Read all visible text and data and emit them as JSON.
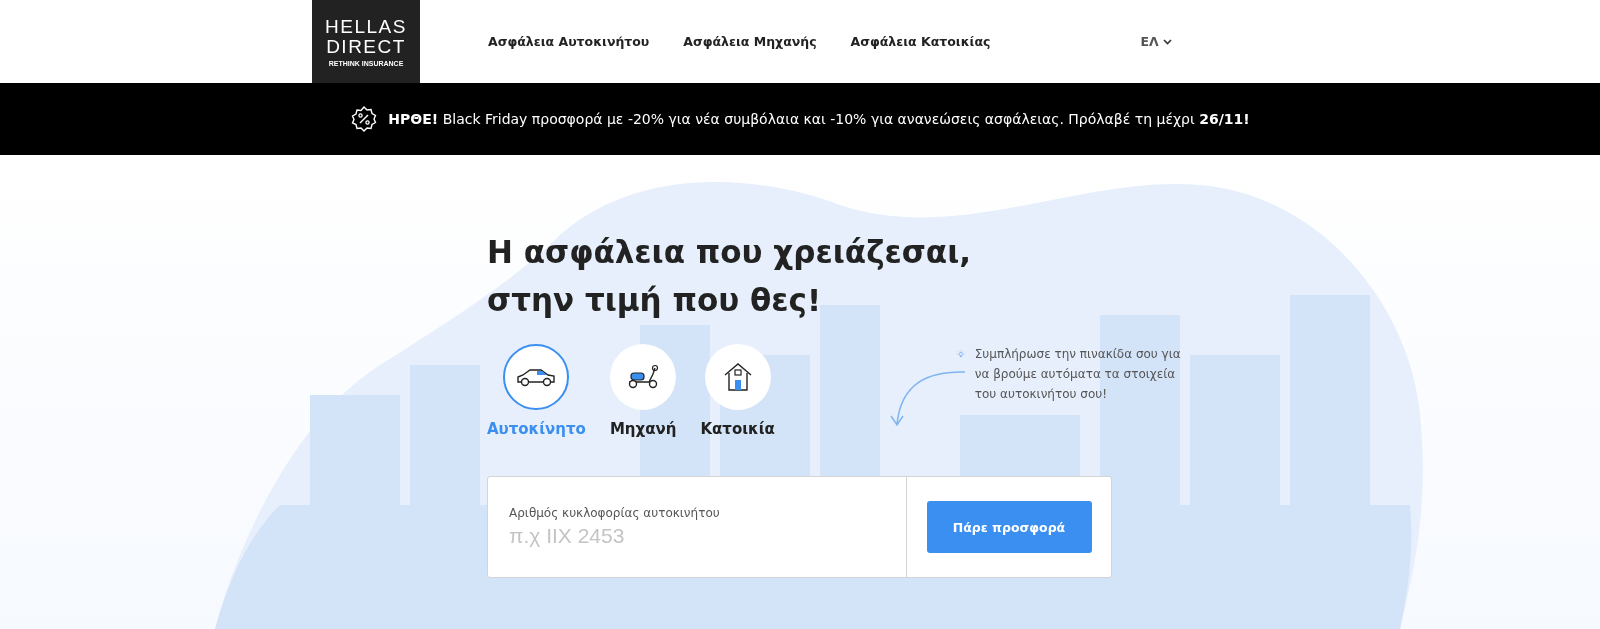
{
  "logo": {
    "lines": [
      "HELLAS",
      "DIRECT"
    ],
    "tagline": "RETHINK INSURANCE"
  },
  "nav": [
    "Ασφάλεια Αυτοκινήτου",
    "Ασφάλεια Μηχανής",
    "Ασφάλεια Κατοικίας"
  ],
  "language": "ΕΛ",
  "banner": "**ΗΡΘΕ!** Black Friday προσφορά με -20% για νέα συμβόλαια και -10% για ανανεώσεις ασφάλειας. Πρόλαβέ τη μέχρι **26/11!**",
  "heading": [
    "Η ασφάλεια που χρειάζεσαι,",
    "στην τιμή που θες!"
  ],
  "tabs": [
    {
      "label": "Αυτοκίνητο",
      "kind": "car",
      "selected": true
    },
    {
      "label": "Μηχανή",
      "kind": "scooter",
      "selected": false
    },
    {
      "label": "Κατοικία",
      "kind": "house",
      "selected": false
    }
  ],
  "tip": "Συμπλήρωσε την πινακίδα σου για να βρούμε αυτόματα τα στοιχεία του αυτοκινήτου σου!",
  "form": {
    "label": "Αριθμός κυκλοφορίας αυτοκινήτου",
    "placeholder": "π.χ ΙΙΧ 2453",
    "button": "Πάρε προσφορά"
  }
}
